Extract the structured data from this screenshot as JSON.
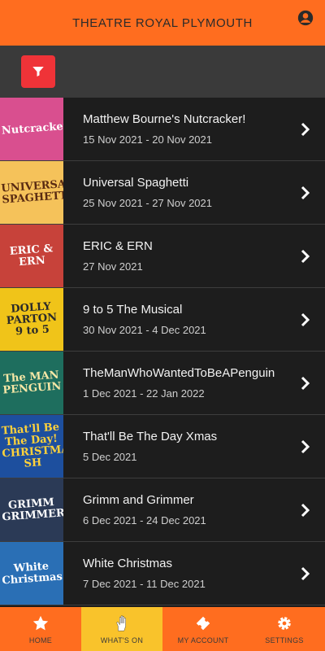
{
  "header": {
    "title": "THEATRE ROYAL PLYMOUTH",
    "account_icon": "account-circle-icon"
  },
  "filter": {
    "icon": "filter-icon"
  },
  "shows": [
    {
      "title": "Matthew Bourne's Nutcracker!",
      "dates": "15 Nov 2021 - 20 Nov 2021",
      "thumb_text": "Nutcracker",
      "thumb_bg": "#d94f8f",
      "thumb_fg": "#ffffff"
    },
    {
      "title": "Universal Spaghetti",
      "dates": "25 Nov 2021 - 27 Nov 2021",
      "thumb_text": "UNIVERSAL SPAGHETTI",
      "thumb_bg": "#f5c25a",
      "thumb_fg": "#5a2b12"
    },
    {
      "title": "ERIC & ERN",
      "dates": "27 Nov 2021",
      "thumb_text": "ERIC & ERN",
      "thumb_bg": "#c7423a",
      "thumb_fg": "#ffffff"
    },
    {
      "title": "9 to 5 The Musical",
      "dates": "30 Nov 2021 - 4 Dec 2021",
      "thumb_text": "DOLLY PARTON 9 to 5",
      "thumb_bg": "#f0c419",
      "thumb_fg": "#2a2a2a"
    },
    {
      "title": "TheManWhoWantedToBeAPenguin",
      "dates": "1 Dec 2021 - 22 Jan 2022",
      "thumb_text": "The MAN PENGUIN",
      "thumb_bg": "#1e6e5e",
      "thumb_fg": "#f6e7a6"
    },
    {
      "title": "That'll Be The Day Xmas",
      "dates": "5 Dec 2021",
      "thumb_text": "That'll Be The Day! CHRISTMAS SH",
      "thumb_bg": "#1d4f9e",
      "thumb_fg": "#ffd23a"
    },
    {
      "title": "Grimm and Grimmer",
      "dates": "6 Dec 2021 - 24 Dec 2021",
      "thumb_text": "GRIMM GRIMMER",
      "thumb_bg": "#2b3a56",
      "thumb_fg": "#ffffff"
    },
    {
      "title": "White Christmas",
      "dates": "7 Dec 2021 - 11 Dec 2021",
      "thumb_text": "White Christmas",
      "thumb_bg": "#2a6fb5",
      "thumb_fg": "#ffffff"
    }
  ],
  "tabs": [
    {
      "label": "HOME",
      "icon": "star-icon",
      "active": false
    },
    {
      "label": "WHAT'S ON",
      "icon": "hand-icon",
      "active": true
    },
    {
      "label": "MY ACCOUNT",
      "icon": "ticket-icon",
      "active": false
    },
    {
      "label": "SETTINGS",
      "icon": "gear-icon",
      "active": false
    }
  ],
  "colors": {
    "accent": "#ff6d1f",
    "active_tab": "#f9c32b",
    "filter_button": "#ef3338"
  }
}
